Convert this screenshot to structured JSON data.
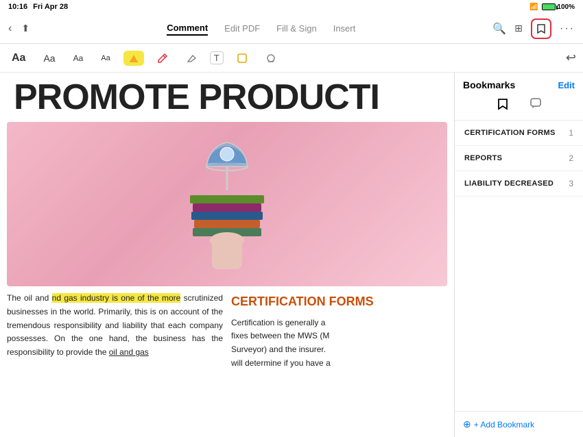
{
  "statusBar": {
    "time": "10:16",
    "date": "Fri Apr 28",
    "wifi": "WiFi",
    "signal": "●●●●",
    "battery": "100%"
  },
  "toolbar": {
    "backLabel": "‹",
    "shareLabel": "↑",
    "tabs": [
      {
        "label": "Comment",
        "active": true
      },
      {
        "label": "Edit PDF",
        "active": false
      },
      {
        "label": "Fill & Sign",
        "active": false
      },
      {
        "label": "Insert",
        "active": false
      }
    ],
    "searchIcon": "🔍",
    "gridIcon": "⊞",
    "bookmarkIcon": "🔖",
    "moreIcon": "···"
  },
  "annotationToolbar": {
    "buttons": [
      {
        "label": "Aa",
        "style": "normal",
        "size": "normal"
      },
      {
        "label": "Aa",
        "style": "normal",
        "size": "normal"
      },
      {
        "label": "Aa",
        "style": "normal",
        "size": "normal"
      },
      {
        "label": "Aa",
        "style": "normal",
        "size": "normal"
      }
    ],
    "highlightIcon": "✏",
    "penIcon": "✏",
    "eraserIcon": "⊘",
    "textIcon": "T",
    "stickyIcon": "□",
    "stampIcon": "◎",
    "undoIcon": "↩"
  },
  "pdf": {
    "title": "PROMOTE PRODUCTI",
    "bodyLeft": "The oil and gas industry is one of the more scrutinized businesses in the world. Primarily, this is on account of the tremendous responsibility and liability that each company possesses. On the one hand, the business has the responsibility to provide the oil and gas",
    "highlightedText": "nd gas industry is one of the more",
    "rightTitle": "CERTIFICATION FORMS",
    "rightBody": "Certification is generally a fixes between the MWS (M Surveyor) and the insurer. will determine if you have a"
  },
  "sidebar": {
    "title": "Bookmarks",
    "editLabel": "Edit",
    "tabs": [
      {
        "icon": "bookmark",
        "active": true
      },
      {
        "icon": "comment",
        "active": false
      }
    ],
    "items": [
      {
        "label": "CERTIFICATION FORMS",
        "number": "1"
      },
      {
        "label": "REPORTS",
        "number": "2"
      },
      {
        "label": "LIABILITY DECREASED",
        "number": "3"
      }
    ],
    "addBookmarkLabel": "+ Add Bookmark"
  }
}
